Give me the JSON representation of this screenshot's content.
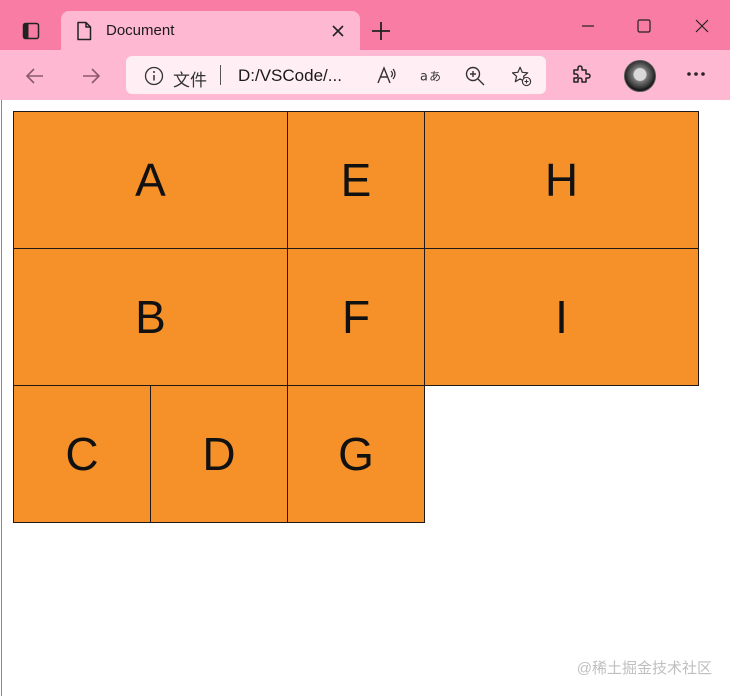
{
  "window": {
    "tab_title": "Document",
    "colors": {
      "titlebar": "#f87ca4",
      "toolbar": "#ffb8d1",
      "accent": "#f59128"
    }
  },
  "toolbar": {
    "site_label": "文件",
    "url": "D:/VSCode/..."
  },
  "grid": {
    "cells": [
      "A",
      "E",
      "H",
      "B",
      "F",
      "I",
      "C",
      "D",
      "G"
    ]
  },
  "watermark": "@稀土掘金技术社区",
  "icons": {
    "tab_actions": "tab-actions-icon",
    "page": "page-icon",
    "close": "close-icon",
    "new_tab": "plus-icon",
    "back": "arrow-left-icon",
    "forward": "arrow-right-icon",
    "info": "info-icon",
    "read_aloud": "read-aloud-icon",
    "translate": "translate-icon",
    "zoom": "zoom-in-icon",
    "favorite": "favorite-star-icon",
    "extensions": "extensions-puzzle-icon",
    "more": "more-dots-icon"
  }
}
